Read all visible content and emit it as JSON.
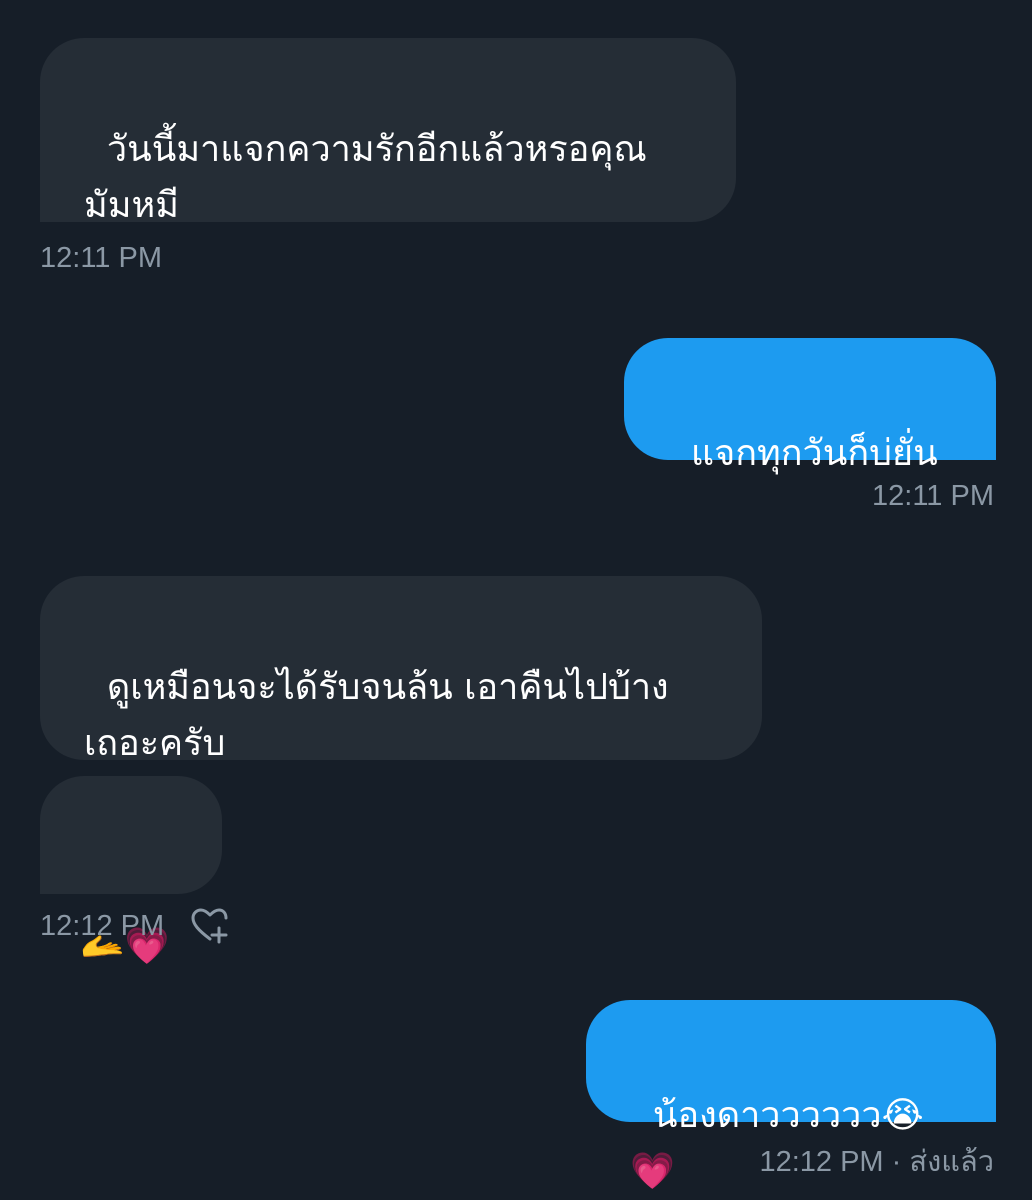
{
  "messages": [
    {
      "direction": "in",
      "text": "วันนี้มาแจกความรักอีกแล้วหรอคุณ\nมัมหมี",
      "time": "12:11 PM"
    },
    {
      "direction": "out",
      "text": "แจกทุกวันก็บ่ยั่น",
      "time": "12:11 PM"
    },
    {
      "direction": "in",
      "text": "ดูเหมือนจะได้รับจนล้น เอาคืนไปบ้าง\nเถอะครับ"
    },
    {
      "direction": "in",
      "text": "🫴💗",
      "time": "12:12 PM"
    },
    {
      "direction": "out",
      "text": "น้องดาวววววว😭💗",
      "time": "12:12 PM",
      "status": "ส่งแล้ว",
      "separator": "·"
    }
  ],
  "icons": {
    "react": "heart-plus-icon"
  },
  "colors": {
    "background": "#161e28",
    "incoming_bubble": "#252d36",
    "outgoing_bubble": "#1d9bf0",
    "meta_text": "#8b98a5"
  }
}
